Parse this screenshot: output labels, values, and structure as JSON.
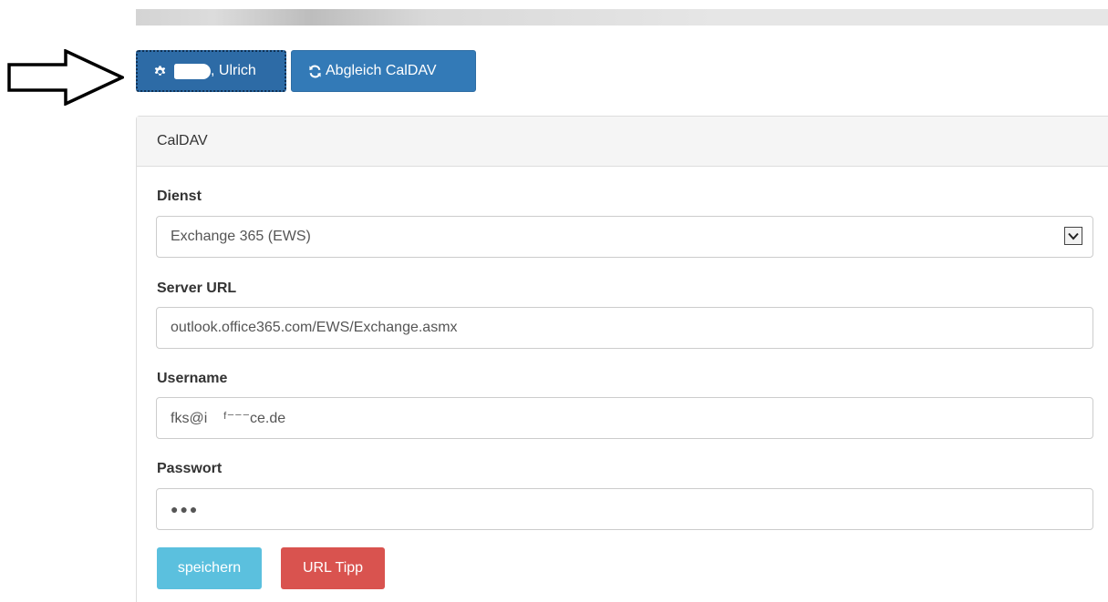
{
  "toolbar": {
    "user_button_label": ", Ulrich",
    "sync_button_label": "Abgleich CalDAV"
  },
  "panel": {
    "heading": "CalDAV"
  },
  "form": {
    "dienst_label": "Dienst",
    "dienst_value": "Exchange 365 (EWS)",
    "server_url_label": "Server URL",
    "server_url_value": "outlook.office365.com/EWS/Exchange.asmx",
    "username_label": "Username",
    "username_value": "fks@i    ᶠ⁻⁻⁻ce.de",
    "password_label": "Passwort",
    "password_value": "●●●"
  },
  "actions": {
    "save_label": "speichern",
    "url_tip_label": "URL Tipp"
  },
  "colors": {
    "primary": "#337ab7",
    "primary_dark": "#2d6ba6",
    "info": "#5bc0de",
    "danger": "#d9534f",
    "panel_heading_bg": "#f5f5f5"
  },
  "icons": {
    "user_button": "gear-icon",
    "sync_button": "refresh-icon",
    "select": "chevron-down-icon",
    "annotation": "arrow-right-outline-icon"
  }
}
